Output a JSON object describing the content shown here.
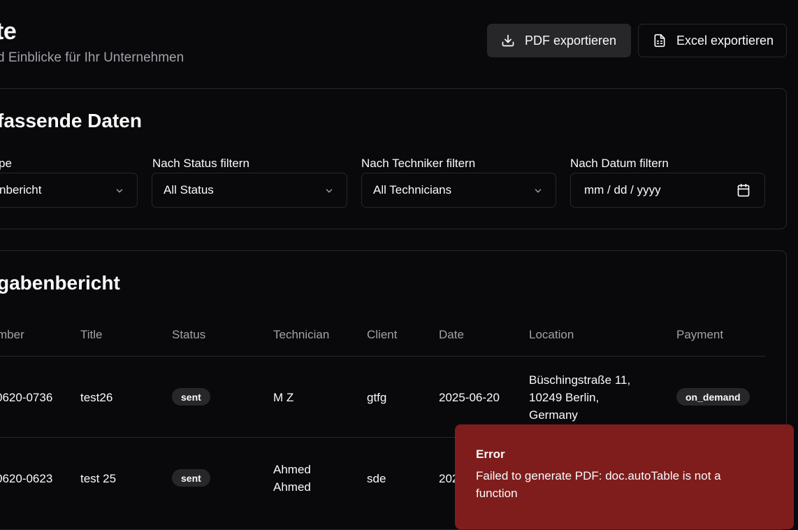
{
  "header": {
    "title": "te",
    "subtitle": "d Einblicke für Ihr Unternehmen",
    "pdf_button": "PDF exportieren",
    "excel_button": "Excel exportieren"
  },
  "filters_card": {
    "title": "fassende Daten",
    "filters": [
      {
        "label": "pe",
        "value": "nbericht"
      },
      {
        "label": "Nach Status filtern",
        "value": "All Status"
      },
      {
        "label": "Nach Techniker filtern",
        "value": "All Technicians"
      },
      {
        "label": "Nach Datum filtern",
        "placeholder": "mm / dd / yyyy"
      }
    ]
  },
  "report_card": {
    "title": "gabenbericht",
    "columns": [
      "mber",
      "Title",
      "Status",
      "Technician",
      "Client",
      "Date",
      "Location",
      "Payment"
    ],
    "rows": [
      {
        "number": "0620-0736",
        "title": "test26",
        "status": "sent",
        "technician": [
          "M Z"
        ],
        "client": "gtfg",
        "date": "2025-06-20",
        "location": [
          "Büschingstraße 11,",
          "10249 Berlin,",
          "Germany"
        ],
        "payment": "on_demand"
      },
      {
        "number": "0620-0623",
        "title": "test 25",
        "status": "sent",
        "technician": [
          "Ahmed",
          "Ahmed"
        ],
        "client": "sde",
        "date": "202",
        "location": [],
        "payment": ""
      }
    ]
  },
  "toast": {
    "title": "Error",
    "message": "Failed to generate PDF: doc.autoTable is not a function"
  }
}
